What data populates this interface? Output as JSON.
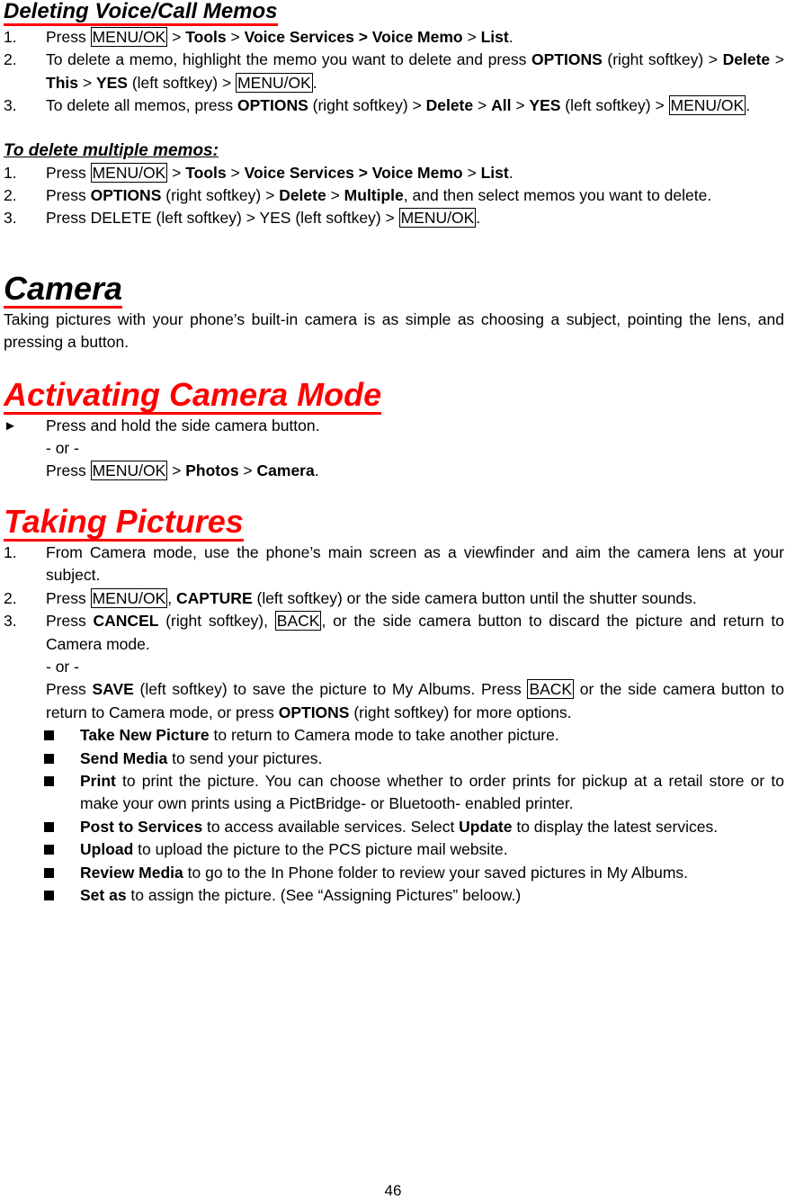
{
  "voice_memos": {
    "title": "Deleting Voice/Call Memos",
    "steps": [
      {
        "num": "1.",
        "parts": [
          "Press ",
          "MENU/OK",
          " > ",
          "Tools",
          " > ",
          "Voice Services > Voice Memo",
          " > ",
          "List",
          "."
        ]
      },
      {
        "num": "2.",
        "parts": [
          "To delete a memo, highlight the memo you want to delete and press ",
          "OPTIONS",
          " (right softkey) > ",
          "Delete",
          " > ",
          "This",
          " > ",
          "YES",
          " (left softkey) > ",
          "MENU/OK",
          "."
        ]
      },
      {
        "num": "3.",
        "parts": [
          "To delete all memos, press ",
          "OPTIONS",
          " (right softkey) > ",
          "Delete",
          " > ",
          "All",
          " > ",
          "YES",
          " (left softkey) > ",
          "MENU/OK",
          "."
        ]
      }
    ]
  },
  "multiple_memos": {
    "title": "To delete multiple memos:",
    "steps": [
      {
        "num": "1.",
        "parts": [
          "Press ",
          "MENU/OK",
          " > ",
          "Tools",
          " > ",
          "Voice Services > Voice Memo",
          " > ",
          "List",
          "."
        ]
      },
      {
        "num": "2.",
        "parts": [
          "Press ",
          "OPTIONS",
          " (right softkey) > ",
          "Delete",
          " > ",
          "Multiple",
          ", and then select memos you want to delete."
        ]
      },
      {
        "num": "3.",
        "parts": [
          "Press DELETE (left softkey) > YES (left softkey) > ",
          "MENU/OK",
          "."
        ]
      }
    ]
  },
  "camera": {
    "title": "Camera",
    "intro": "Taking pictures with your phone’s built-in camera is as simple as choosing a subject, pointing the lens, and pressing a button."
  },
  "activating": {
    "title": "Activating Camera Mode",
    "line1": "Press and hold the side camera button.",
    "or": "- or -",
    "line3_parts": [
      "Press ",
      "MENU/OK",
      " > ",
      "Photos",
      " > ",
      "Camera",
      "."
    ]
  },
  "taking": {
    "title": "Taking Pictures",
    "steps": [
      {
        "num": "1.",
        "parts": [
          "From Camera mode, use the phone’s main screen as a viewfinder and aim the camera lens at your subject."
        ]
      },
      {
        "num": "2.",
        "parts": [
          "Press ",
          "MENU/OK",
          ", ",
          "CAPTURE",
          " (left softkey) or the side camera button until the shutter sounds."
        ]
      },
      {
        "num": "3.",
        "parts": [
          "Press ",
          "CANCEL",
          " (right softkey), ",
          "BACK",
          ", or the side camera button to discard the picture and return to Camera mode."
        ]
      }
    ],
    "or": "- or -",
    "save_parts": [
      "Press ",
      "SAVE",
      " (left softkey) to save the picture to My Albums. Press ",
      "BACK",
      " or the side camera button to return to Camera mode, or press ",
      "OPTIONS",
      " (right softkey) for more options."
    ],
    "options": [
      {
        "label": "Take New Picture",
        "text": " to return to Camera mode to take another picture."
      },
      {
        "label": "Send Media",
        "text": " to send your pictures."
      },
      {
        "label": "Print",
        "text": " to print the picture. You can choose whether to order prints for pickup at a retail store or to make your own prints using a PictBridge- or Bluetooth- enabled printer."
      },
      {
        "label": "Post to Services",
        "text": " to access available services. Select ",
        "label2": "Update",
        "text2": " to display the latest services."
      },
      {
        "label": "Upload",
        "text": " to upload the picture to the PCS picture mail website."
      },
      {
        "label": "Review Media",
        "text": " to go to the In Phone folder to review your saved pictures in My Albums."
      },
      {
        "label": "Set as",
        "text": " to assign the picture. (See “Assigning Pictures” beloow.)"
      }
    ]
  },
  "footer": {
    "page_number": "46"
  }
}
